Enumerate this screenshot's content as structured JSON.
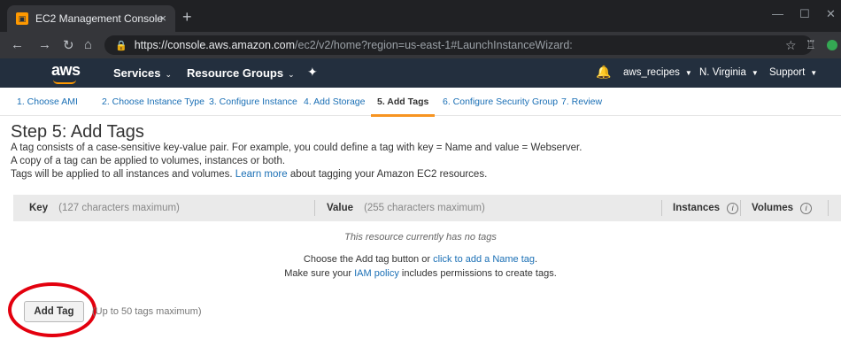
{
  "browser": {
    "tab_title": "EC2 Management Console",
    "tab_close": "×",
    "new_tab": "+",
    "url_host": "https://console.aws.amazon.com",
    "url_path": "/ec2/v2/home?region=us-east-1#LaunchInstanceWizard:"
  },
  "aws_nav": {
    "logo": "aws",
    "services": "Services",
    "resource_groups": "Resource Groups",
    "account": "aws_recipes",
    "region": "N. Virginia",
    "support": "Support"
  },
  "wizard": {
    "steps": [
      "1. Choose AMI",
      "2. Choose Instance Type",
      "3. Configure Instance",
      "4. Add Storage",
      "5. Add Tags",
      "6. Configure Security Group",
      "7. Review"
    ],
    "active_step": 4
  },
  "content": {
    "title": "Step 5: Add Tags",
    "line1": "A tag consists of a case-sensitive key-value pair. For example, you could define a tag with key = Name and value = Webserver.",
    "line2": "A copy of a tag can be applied to volumes, instances or both.",
    "line3_pre": "Tags will be applied to all instances and volumes.",
    "learn_more": "Learn more",
    "line3_post": "about tagging your Amazon EC2 resources."
  },
  "table": {
    "key_header": "Key",
    "key_hint": "(127 characters maximum)",
    "value_header": "Value",
    "value_hint": "(255 characters maximum)",
    "instances_header": "Instances",
    "volumes_header": "Volumes",
    "empty_message": "This resource currently has no tags",
    "choose_pre": "Choose the Add tag button or",
    "choose_link": "click to add a Name tag",
    "make_sure_pre": "Make sure your",
    "iam_link": "IAM policy",
    "make_sure_post": "includes permissions to create tags."
  },
  "actions": {
    "add_tag": "Add Tag",
    "add_tag_hint": "(Up to 50 tags maximum)"
  },
  "colors": {
    "aws_nav_bg": "#232f3e",
    "aws_orange": "#ff9900",
    "link_blue": "#1a6fb5",
    "highlight_red": "#e3000e"
  }
}
